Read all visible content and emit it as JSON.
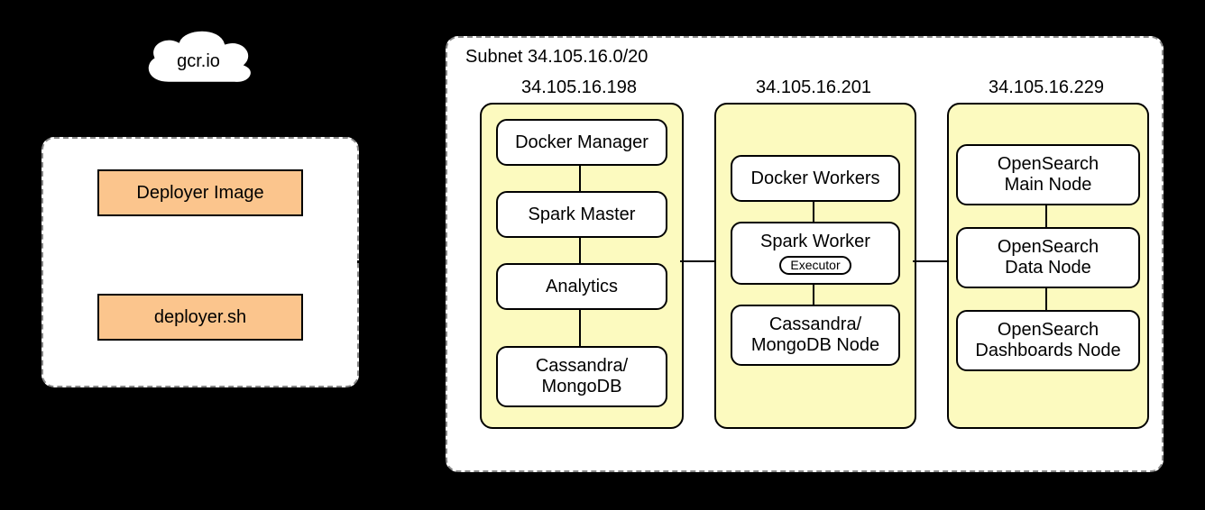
{
  "cloud": {
    "label": "gcr.io"
  },
  "deployer": {
    "image_box": "Deployer Image",
    "script_box": "deployer.sh"
  },
  "subnet": {
    "title": "Subnet 34.105.16.0/20",
    "nodes": [
      {
        "ip": "34.105.16.198",
        "services": [
          {
            "label": "Docker Manager"
          },
          {
            "label": "Spark Master"
          },
          {
            "label": "Analytics"
          },
          {
            "label": "Cassandra/\nMongoDB"
          }
        ]
      },
      {
        "ip": "34.105.16.201",
        "services": [
          {
            "label": "Docker Workers"
          },
          {
            "label": "Spark Worker",
            "sublabel": "Executor"
          },
          {
            "label": "Cassandra/\nMongoDB Node"
          }
        ]
      },
      {
        "ip": "34.105.16.229",
        "services": [
          {
            "label": "OpenSearch\nMain Node"
          },
          {
            "label": "OpenSearch\nData Node"
          },
          {
            "label": "OpenSearch\nDashboards Node"
          }
        ]
      }
    ]
  }
}
